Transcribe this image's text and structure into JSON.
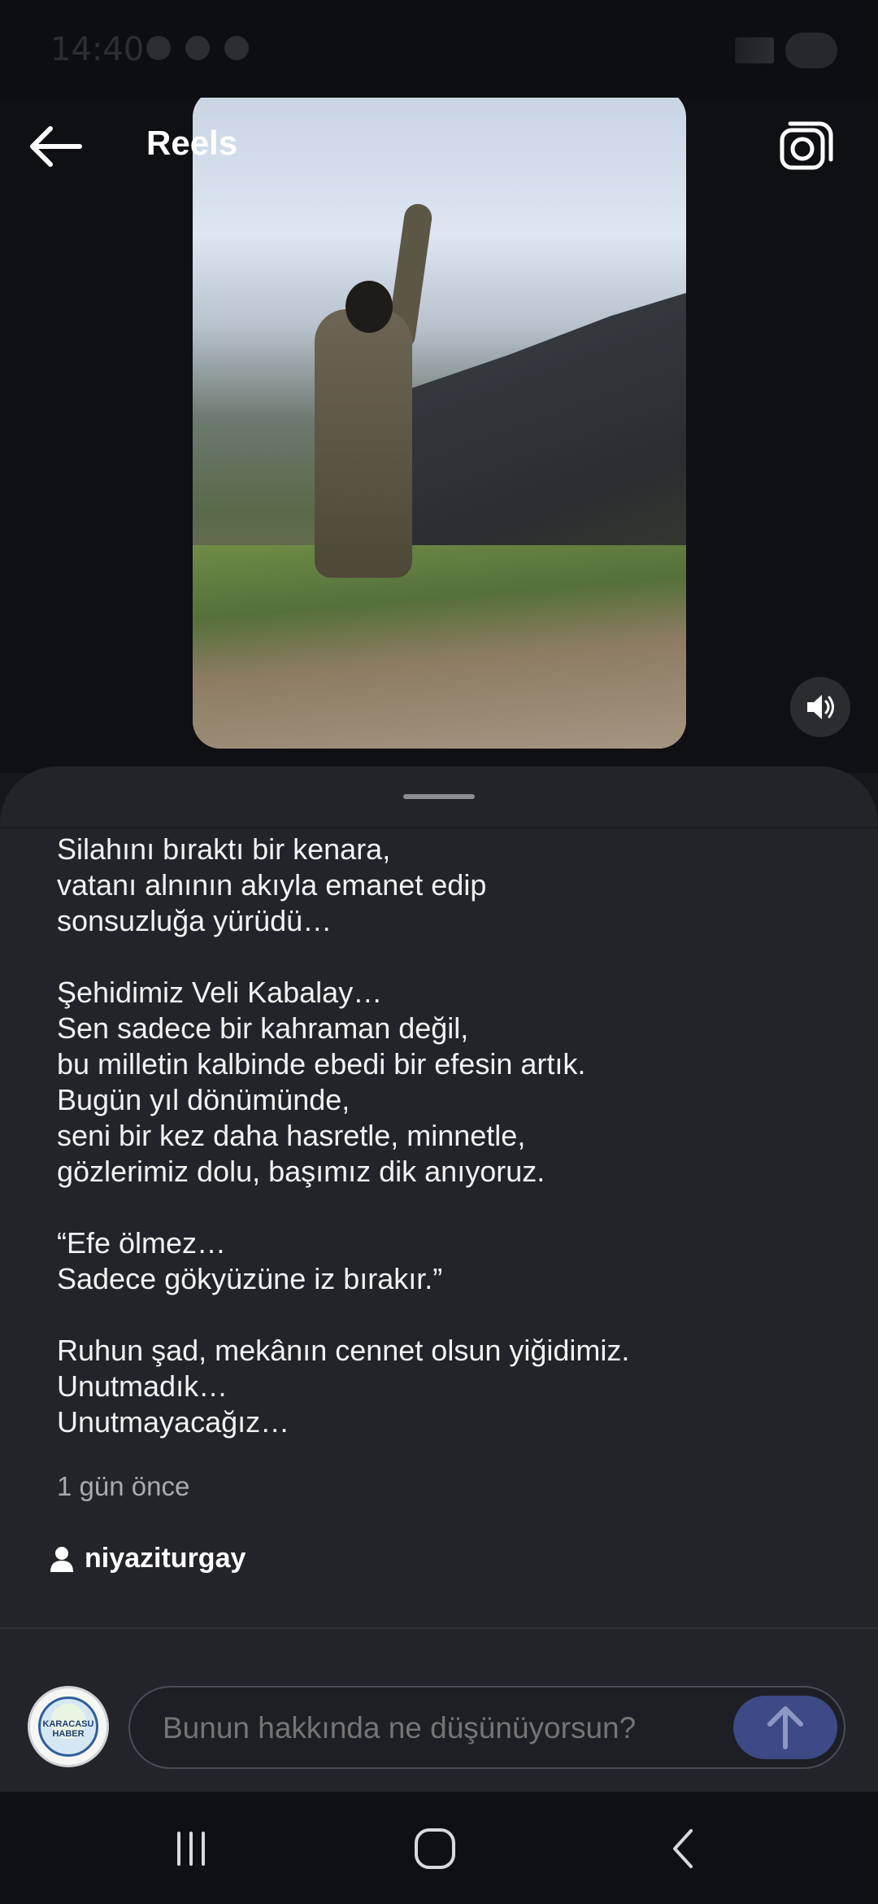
{
  "status_bar": {
    "time": "14:40"
  },
  "header": {
    "title": "Reels"
  },
  "caption": {
    "text": "Silahını bıraktı bir kenara,\nvatanı alnının akıyla emanet edip\nsonsuzluğa yürüdü…\n\nŞehidimiz Veli Kabalay…\nSen sadece bir kahraman değil,\nbu milletin kalbinde ebedi bir efesin artık.\nBugün yıl dönümünde,\nseni bir kez daha hasretle, minnetle,\ngözlerimiz dolu, başımız dik anıyoruz.\n\n“Efe ölmez…\nSadece gökyüzüne iz bırakır.”\n\nRuhun şad, mekânın cennet olsun yiğidimiz.\nUnutmadık…\nUnutmayacağız…",
    "time_ago": "1 gün önce",
    "author": "niyaziturgay"
  },
  "comment": {
    "placeholder": "Bunun hakkında ne düşünüyorsun?",
    "avatar_text": "KARACASU HABER"
  },
  "icons": {
    "back": "arrow-left-icon",
    "camera": "camera-icon",
    "volume": "speaker-icon",
    "send": "arrow-up-icon",
    "user": "person-icon"
  },
  "colors": {
    "accent": "#3d4a86",
    "sheet": "#22242a"
  }
}
